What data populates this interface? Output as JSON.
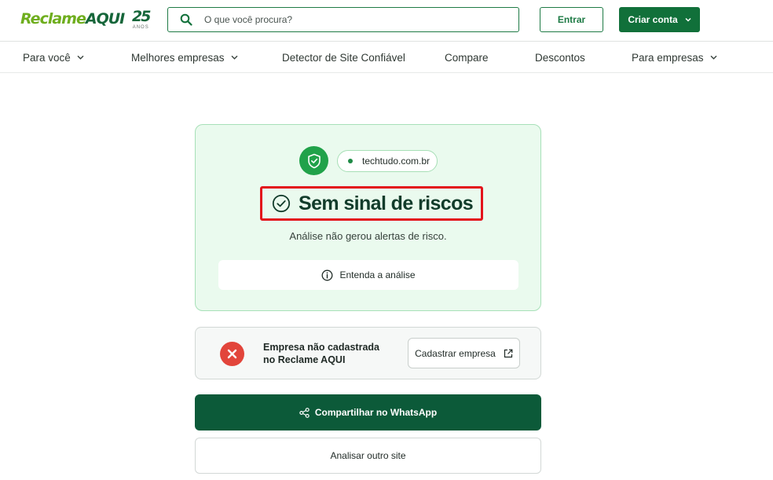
{
  "header": {
    "logo": {
      "reclame": "Reclame",
      "aqui": "AQUI",
      "anniversary_number": "25",
      "anniversary_label": "ANOS"
    },
    "search": {
      "placeholder": "O que você procura?",
      "value": ""
    },
    "login_label": "Entrar",
    "signup_label": "Criar conta"
  },
  "nav": {
    "items": [
      {
        "label": "Para você",
        "has_dropdown": true
      },
      {
        "label": "Melhores empresas",
        "has_dropdown": true
      },
      {
        "label": "Detector de Site Confiável",
        "has_dropdown": false
      },
      {
        "label": "Compare",
        "has_dropdown": false
      },
      {
        "label": "Descontos",
        "has_dropdown": false
      },
      {
        "label": "Para empresas",
        "has_dropdown": true
      }
    ]
  },
  "result": {
    "domain": "techtudo.com.br",
    "title": "Sem sinal de riscos",
    "subtitle": "Análise não gerou alertas de risco.",
    "details_label": "Entenda a análise"
  },
  "company": {
    "status_line1": "Empresa não cadastrada",
    "status_line2": "no Reclame AQUI",
    "register_label": "Cadastrar empresa"
  },
  "actions": {
    "share_label": "Compartilhar no WhatsApp",
    "analyze_other_label": "Analisar outro site"
  },
  "colors": {
    "brand_green": "#11703a",
    "success_green": "#21a24a",
    "card_bg": "#eafaee",
    "danger_red": "#e2453b",
    "highlight_red": "#e3131b",
    "dark_green": "#0c5a39"
  },
  "icons": [
    "search-icon",
    "chevron-down-icon",
    "shield-check-icon",
    "check-circle-icon",
    "info-icon",
    "close-icon",
    "external-link-icon",
    "share-icon"
  ]
}
